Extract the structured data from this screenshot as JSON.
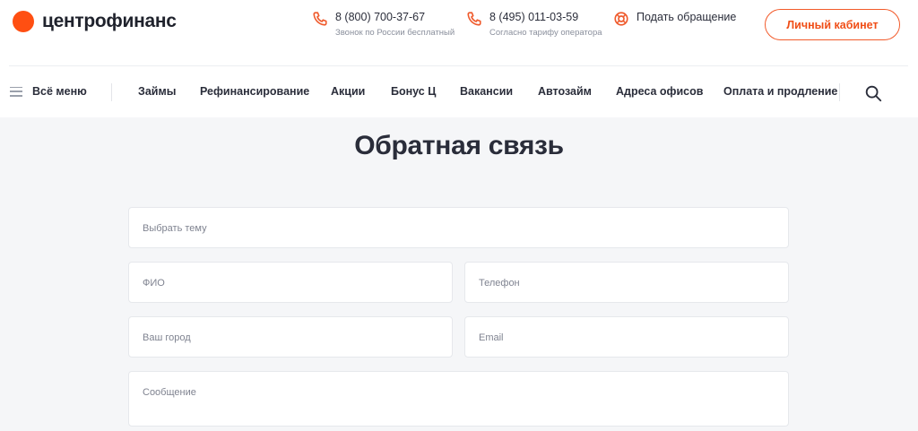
{
  "header": {
    "logo_text": "центрофинанс",
    "contacts": [
      {
        "phone": "8 (800) 700-37-67",
        "note": "Звонок по России бесплатный",
        "icon": "phone-icon"
      },
      {
        "phone": "8 (495) 011-03-59",
        "note": "Согласно тарифу оператора",
        "icon": "phone-icon"
      }
    ],
    "appeal_label": "Подать обращение",
    "cabinet_label": "Личный кабинет",
    "accent_color": "#ff4f12"
  },
  "nav": {
    "menu_label": "Всё меню",
    "items": [
      "Займы",
      "Рефинансирование",
      "Акции",
      "Бонус Ц",
      "Вакансии",
      "Автозайм",
      "Адреса офисов",
      "Оплата и продление"
    ]
  },
  "form": {
    "title": "Обратная связь",
    "topic_placeholder": "Выбрать тему",
    "name_placeholder": "ФИО",
    "phone_placeholder": "Телефон",
    "city_placeholder": "Ваш город",
    "email_placeholder": "Email",
    "message_placeholder": "Сообщение"
  }
}
